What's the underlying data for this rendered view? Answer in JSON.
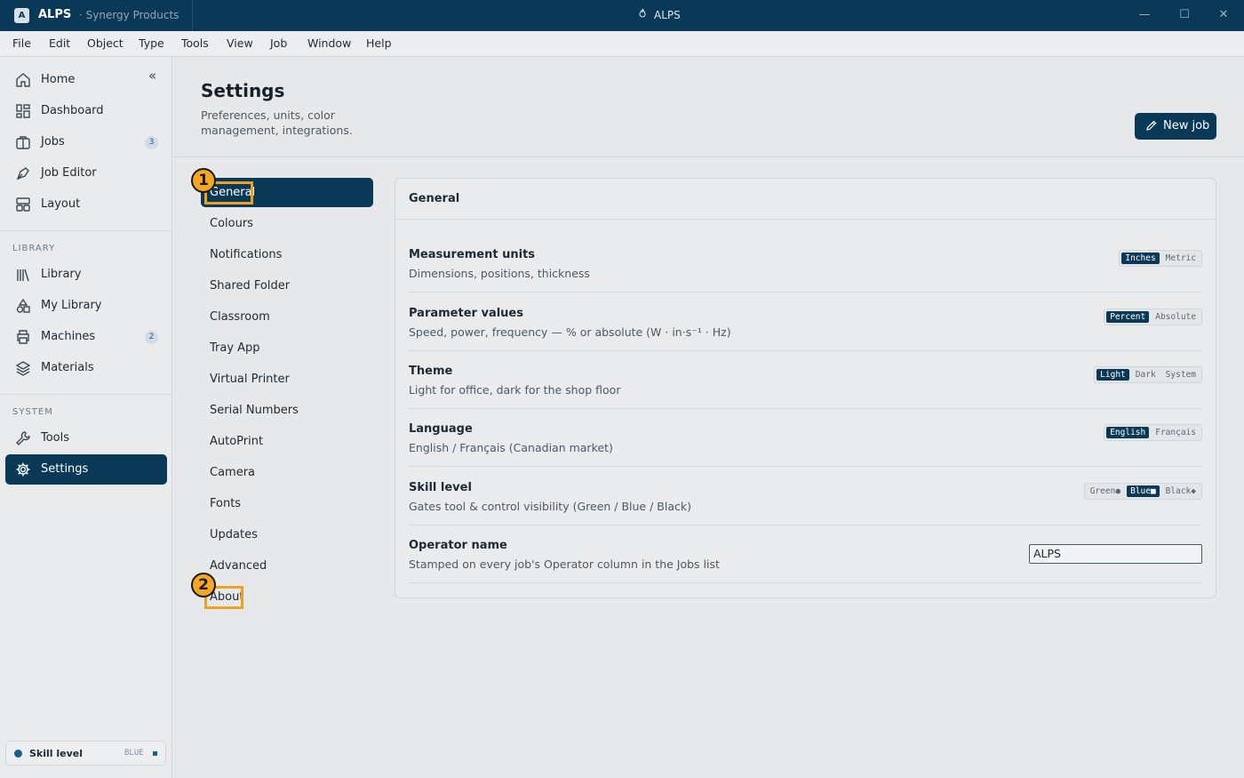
{
  "titlebar": {
    "app_badge": "A",
    "app_name": "ALPS",
    "subtitle": "· Synergy Products",
    "window_title": "ALPS",
    "minimize": "—",
    "maximize": "☐",
    "close": "✕"
  },
  "menu": [
    "File",
    "Edit",
    "Object",
    "Type",
    "Tools",
    "View",
    "Job",
    "Window",
    "Help"
  ],
  "sidebar": {
    "collapse": "«",
    "items": [
      {
        "label": "Home",
        "icon": "home-icon"
      },
      {
        "label": "Dashboard",
        "icon": "dashboard-icon"
      },
      {
        "label": "Jobs",
        "icon": "briefcase-icon",
        "badge": "3"
      },
      {
        "label": "Job Editor",
        "icon": "pen-tool-icon"
      },
      {
        "label": "Layout",
        "icon": "layout-icon"
      }
    ],
    "library_label": "LIBRARY",
    "library_items": [
      {
        "label": "Library",
        "icon": "books-icon"
      },
      {
        "label": "My Library",
        "icon": "shapes-icon"
      },
      {
        "label": "Machines",
        "icon": "printer-icon",
        "badge": "2"
      },
      {
        "label": "Materials",
        "icon": "layers-icon"
      }
    ],
    "system_label": "SYSTEM",
    "system_items": [
      {
        "label": "Tools",
        "icon": "wrench-icon"
      },
      {
        "label": "Settings",
        "icon": "gear-icon"
      }
    ],
    "skill": {
      "label": "Skill level",
      "value": "BLUE"
    }
  },
  "header": {
    "title": "Settings",
    "description": "Preferences, units, color management, integrations.",
    "new_job": "New job"
  },
  "subnav": [
    "General",
    "Colours",
    "Notifications",
    "Shared Folder",
    "Classroom",
    "Tray App",
    "Virtual Printer",
    "Serial Numbers",
    "AutoPrint",
    "Camera",
    "Fonts",
    "Updates",
    "Advanced",
    "About"
  ],
  "markers": {
    "m1": "1",
    "m2": "2"
  },
  "panel": {
    "title": "General",
    "rows": [
      {
        "label": "Measurement units",
        "desc": "Dimensions, positions, thickness",
        "options": [
          "Inches",
          "Metric"
        ],
        "selected": "Inches"
      },
      {
        "label": "Parameter values",
        "desc": "Speed, power, frequency — % or absolute (W · in·s⁻¹ · Hz)",
        "options": [
          "Percent",
          "Absolute"
        ],
        "selected": "Percent"
      },
      {
        "label": "Theme",
        "desc": "Light for office, dark for the shop floor",
        "options": [
          "Light",
          "Dark",
          "System"
        ],
        "selected": "Light"
      },
      {
        "label": "Language",
        "desc": "English / Français (Canadian market)",
        "options": [
          "English",
          "Français"
        ],
        "selected": "English"
      },
      {
        "label": "Skill level",
        "desc": "Gates tool & control visibility (Green / Blue / Black)",
        "options": [
          "Green●",
          "Blue■",
          "Black◆"
        ],
        "selected": "Blue■"
      },
      {
        "label": "Operator name",
        "desc": "Stamped on every job's Operator column in the Jobs list",
        "value": "ALPS"
      }
    ]
  },
  "colors": {
    "primary": "#0a3957",
    "highlight": "#f0a020",
    "marker": "#f5a623"
  }
}
